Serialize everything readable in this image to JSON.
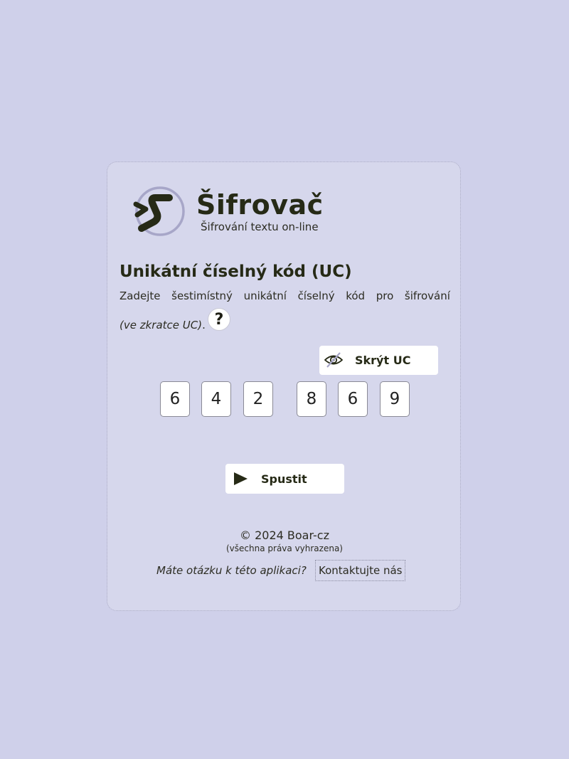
{
  "brand": {
    "title": "Šifrovač",
    "subtitle": "Šifrování textu on-line",
    "logo_icon": "cipher-logo-icon"
  },
  "section": {
    "heading": "Unikátní číselný kód (UC)",
    "intro_words": [
      "Zadejte",
      "šestimístný",
      "unikátní",
      "číselný",
      "kód",
      "pro",
      "šifrování"
    ],
    "intro_italic": "(ve zkratce UC)",
    "intro_end": ".",
    "help_label": "?"
  },
  "hide_button": {
    "label": "Skrýt UC",
    "icon": "eye-slash-icon"
  },
  "code_digits": [
    "6",
    "4",
    "2",
    "8",
    "6",
    "9"
  ],
  "run_button": {
    "label": "Spustit",
    "icon": "play-icon"
  },
  "footer": {
    "copyright": "© 2024 Boar-cz",
    "rights": "(všechna práva vyhrazena)",
    "question": "Máte otázku k této aplikaci?",
    "contact_label": "Kontaktujte nás"
  },
  "colors": {
    "background": "#cfd0ea",
    "card": "#d6d7ec",
    "text_dark": "#262a16",
    "logo_ring": "#a7a6c8"
  }
}
